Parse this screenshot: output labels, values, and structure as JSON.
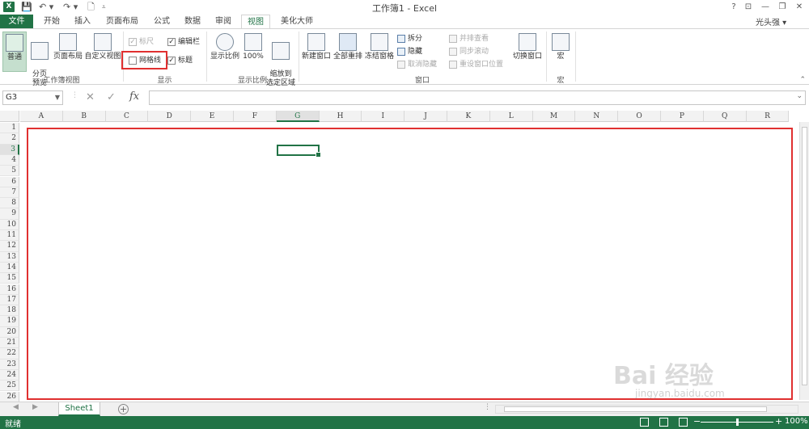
{
  "title_bar": {
    "app_icon": "X",
    "title": "工作簿1 - Excel",
    "window_controls": [
      "?",
      "⊡",
      "—",
      "❐",
      "✕"
    ]
  },
  "tabs": [
    {
      "label": "文件"
    },
    {
      "label": "开始"
    },
    {
      "label": "插入"
    },
    {
      "label": "页面布局"
    },
    {
      "label": "公式"
    },
    {
      "label": "数据"
    },
    {
      "label": "审阅"
    },
    {
      "label": "视图"
    },
    {
      "label": "美化大师"
    }
  ],
  "active_tab": "视图",
  "user": "光头强 ▾",
  "ribbon": {
    "groups": {
      "workbook_views": {
        "label": "工作簿视图",
        "normal": "普通",
        "page_break": "分页\n预览",
        "page_layout": "页面布局",
        "custom_views": "自定义视图"
      },
      "show": {
        "label": "显示",
        "ruler": "标尺",
        "formula_bar": "编辑栏",
        "gridlines": "网格线",
        "headings": "标题"
      },
      "zoom": {
        "label": "显示比例",
        "zoom": "显示比例",
        "hundred": "100%",
        "zoom_to_selection": "缩放到\n选定区域"
      },
      "window": {
        "label": "窗口",
        "new_window": "新建窗口",
        "arrange_all": "全部重排",
        "freeze_panes": "冻结窗格",
        "split": "拆分",
        "hide": "隐藏",
        "unhide": "取消隐藏",
        "side_by_side": "并排查看",
        "sync_scroll": "同步滚动",
        "reset_position": "重设窗口位置",
        "switch_windows": "切换窗口"
      },
      "macros": {
        "label": "宏",
        "macros": "宏"
      }
    },
    "checkbox_states": {
      "ruler": "✓",
      "formula_bar": "✓",
      "gridlines": "",
      "headings": "✓"
    }
  },
  "formula_bar": {
    "name_box": "G3",
    "cancel": "✕",
    "enter": "✓",
    "fx": "fx",
    "formula": ""
  },
  "columns": [
    "A",
    "B",
    "C",
    "D",
    "E",
    "F",
    "G",
    "H",
    "I",
    "J",
    "K",
    "L",
    "M",
    "N",
    "O",
    "P",
    "Q",
    "R"
  ],
  "selected_column": "G",
  "rows": [
    "1",
    "2",
    "3",
    "4",
    "5",
    "6",
    "7",
    "8",
    "9",
    "10",
    "11",
    "12",
    "13",
    "14",
    "15",
    "16",
    "17",
    "18",
    "19",
    "20",
    "21",
    "22",
    "23",
    "24",
    "25",
    "26"
  ],
  "selected_row": "3",
  "sheets": [
    {
      "label": "Sheet1"
    }
  ],
  "add_sheet": "+",
  "status": {
    "ready": "就绪",
    "zoom_minus": "−",
    "zoom_plus": "+",
    "zoom": "100%",
    "zoom_level": 1.0
  },
  "watermark": {
    "text": "Bai 经验",
    "url": "jingyan.baidu.com"
  },
  "colors": {
    "excel_green": "#217346",
    "highlight_red": "#e03030"
  }
}
